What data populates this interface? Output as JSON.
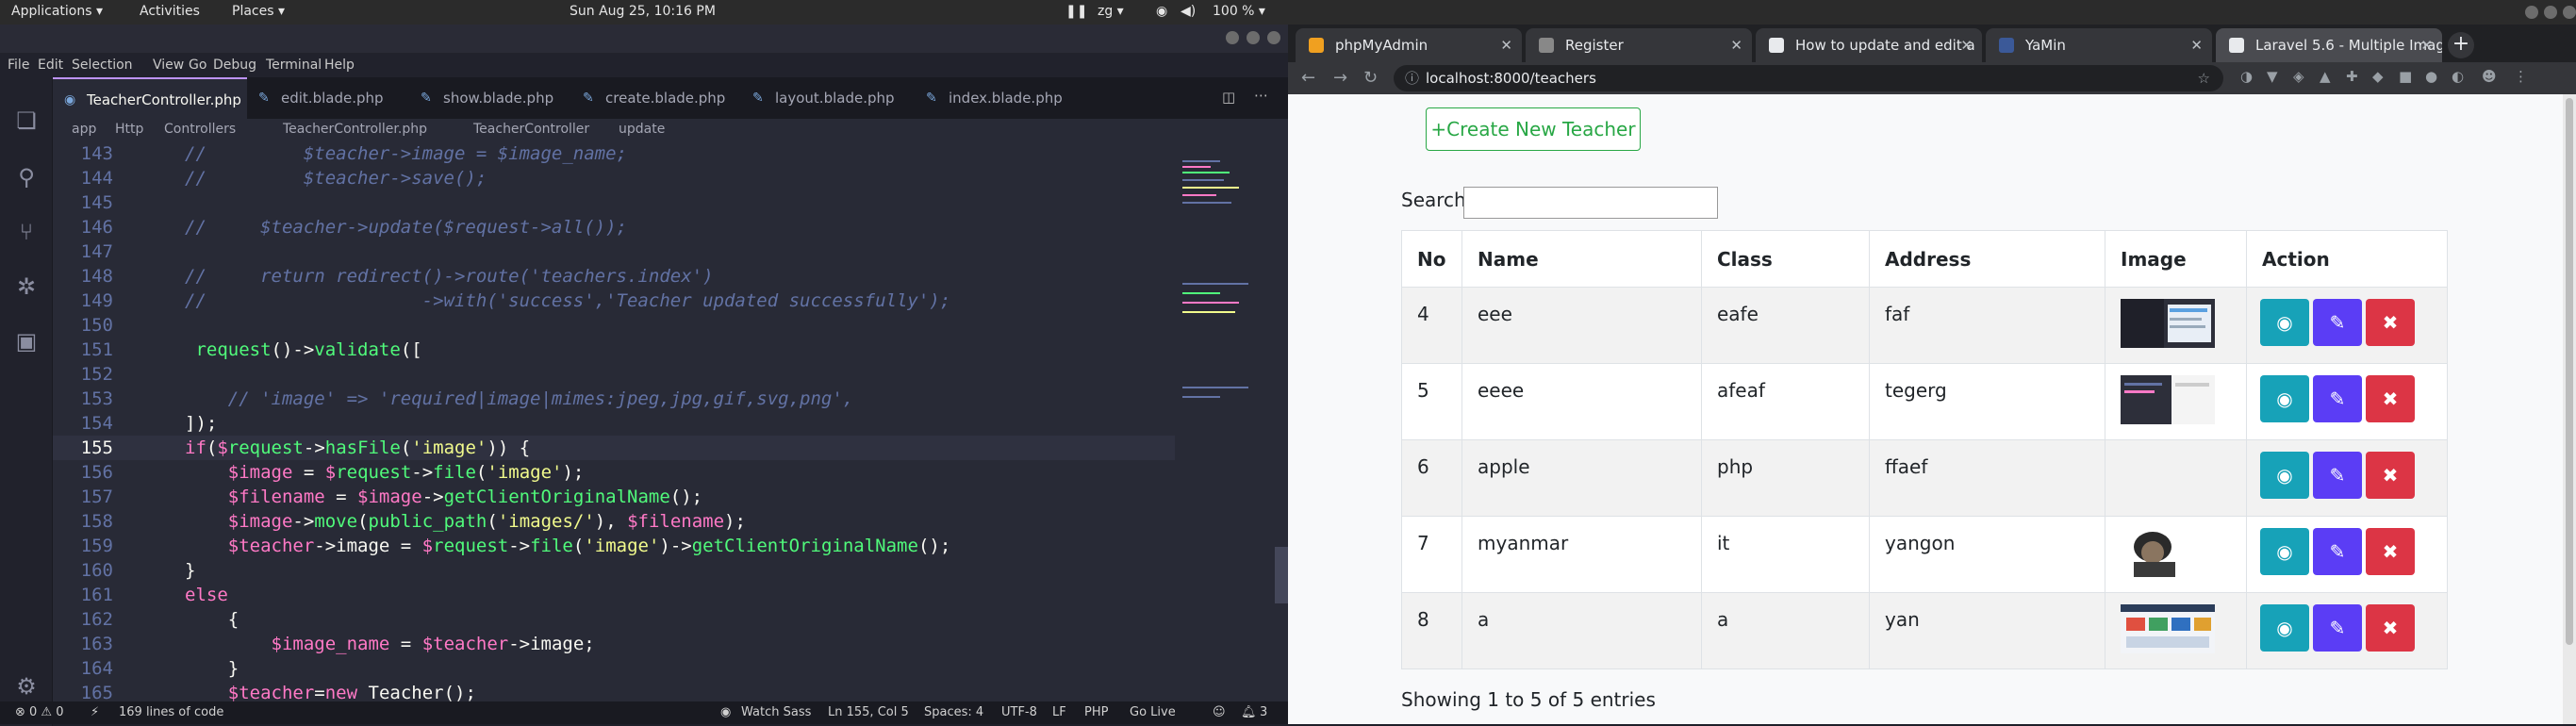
{
  "desktop": {
    "applications": "Applications ▾",
    "activities": "Activities",
    "places": "Places ▾",
    "clock": "Sun Aug 25, 10:16 PM",
    "keyboard": "zg ▾",
    "battery": "100 % ▾"
  },
  "editor": {
    "menu": [
      "File",
      "Edit",
      "Selection",
      "View",
      "Go",
      "Debug",
      "Terminal",
      "Help"
    ],
    "tabs": [
      "TeacherController.php",
      "edit.blade.php",
      "show.blade.php",
      "create.blade.php",
      "layout.blade.php",
      "index.blade.php"
    ],
    "breadcrumb": [
      "app",
      "Http",
      "Controllers",
      "TeacherController.php",
      "TeacherController",
      "update"
    ],
    "lines": [
      {
        "n": "143",
        "t": "//         $teacher->image = $image_name;",
        "k": "comment"
      },
      {
        "n": "144",
        "t": "//         $teacher->save();",
        "k": "comment"
      },
      {
        "n": "145",
        "t": "",
        "k": "plain"
      },
      {
        "n": "146",
        "t": "//     $teacher->update($request->all());",
        "k": "comment"
      },
      {
        "n": "147",
        "t": "",
        "k": "plain"
      },
      {
        "n": "148",
        "t": "//     return redirect()->route('teachers.index')",
        "k": "comment"
      },
      {
        "n": "149",
        "t": "//                    ->with('success','Teacher updated successfully');",
        "k": "comment"
      },
      {
        "n": "150",
        "t": "",
        "k": "plain"
      },
      {
        "n": "151",
        "t": " request()->validate([",
        "k": "code"
      },
      {
        "n": "152",
        "t": "",
        "k": "plain"
      },
      {
        "n": "153",
        "t": "    // 'image' => 'required|image|mimes:jpeg,jpg,gif,svg,png',",
        "k": "comment"
      },
      {
        "n": "154",
        "t": "]);",
        "k": "plain"
      },
      {
        "n": "155",
        "t": "if($request->hasFile('image')) {",
        "k": "code"
      },
      {
        "n": "156",
        "t": "    $image = $request->file('image');",
        "k": "code"
      },
      {
        "n": "157",
        "t": "    $filename = $image->getClientOriginalName();",
        "k": "code"
      },
      {
        "n": "158",
        "t": "    $image->move(public_path('images/'), $filename);",
        "k": "code"
      },
      {
        "n": "159",
        "t": "    $teacher->image = $request->file('image')->getClientOriginalName();",
        "k": "code"
      },
      {
        "n": "160",
        "t": "}",
        "k": "plain"
      },
      {
        "n": "161",
        "t": "else",
        "k": "kw"
      },
      {
        "n": "162",
        "t": "    {",
        "k": "plain"
      },
      {
        "n": "163",
        "t": "        $image_name = $teacher->image;",
        "k": "code"
      },
      {
        "n": "164",
        "t": "    }",
        "k": "plain"
      },
      {
        "n": "165",
        "t": "    $teacher=new Teacher();",
        "k": "code"
      }
    ],
    "status": {
      "errors": "⊗ 0  ⚠ 0",
      "lines_of_code": "169 lines of code",
      "watch_sass": "Watch Sass",
      "position": "Ln 155, Col 5",
      "spaces": "Spaces: 4",
      "encoding": "UTF-8",
      "eol": "LF",
      "lang": "PHP",
      "golive": "Go Live",
      "notif": "3"
    }
  },
  "browser": {
    "tabs": [
      {
        "label": "phpMyAdmin",
        "color": "#f0a020"
      },
      {
        "label": "Register",
        "color": "#888"
      },
      {
        "label": "How to update and edit a",
        "color": "#e8eaed"
      },
      {
        "label": "YaMin",
        "color": "#3b5998"
      },
      {
        "label": "Laravel 5.6 - Multiple Imag",
        "color": "#e8eaed"
      }
    ],
    "url": "localhost:8000/teachers",
    "create_button": "+Create New Teacher",
    "search_label": "Search:",
    "columns": [
      "No",
      "Name",
      "Class",
      "Address",
      "Image",
      "Action"
    ],
    "rows": [
      {
        "no": "4",
        "name": "eee",
        "class": "eafe",
        "address": "faf",
        "image": "screenshot"
      },
      {
        "no": "5",
        "name": "eeee",
        "class": "afeaf",
        "address": "tegerg",
        "image": "screenshot-dark"
      },
      {
        "no": "6",
        "name": "apple",
        "class": "php",
        "address": "ffaef",
        "image": ""
      },
      {
        "no": "7",
        "name": "myanmar",
        "class": "it",
        "address": "yangon",
        "image": "person"
      },
      {
        "no": "8",
        "name": "a",
        "class": "a",
        "address": "yan",
        "image": "web"
      }
    ],
    "info": "Showing 1 to 5 of 5 entries"
  }
}
